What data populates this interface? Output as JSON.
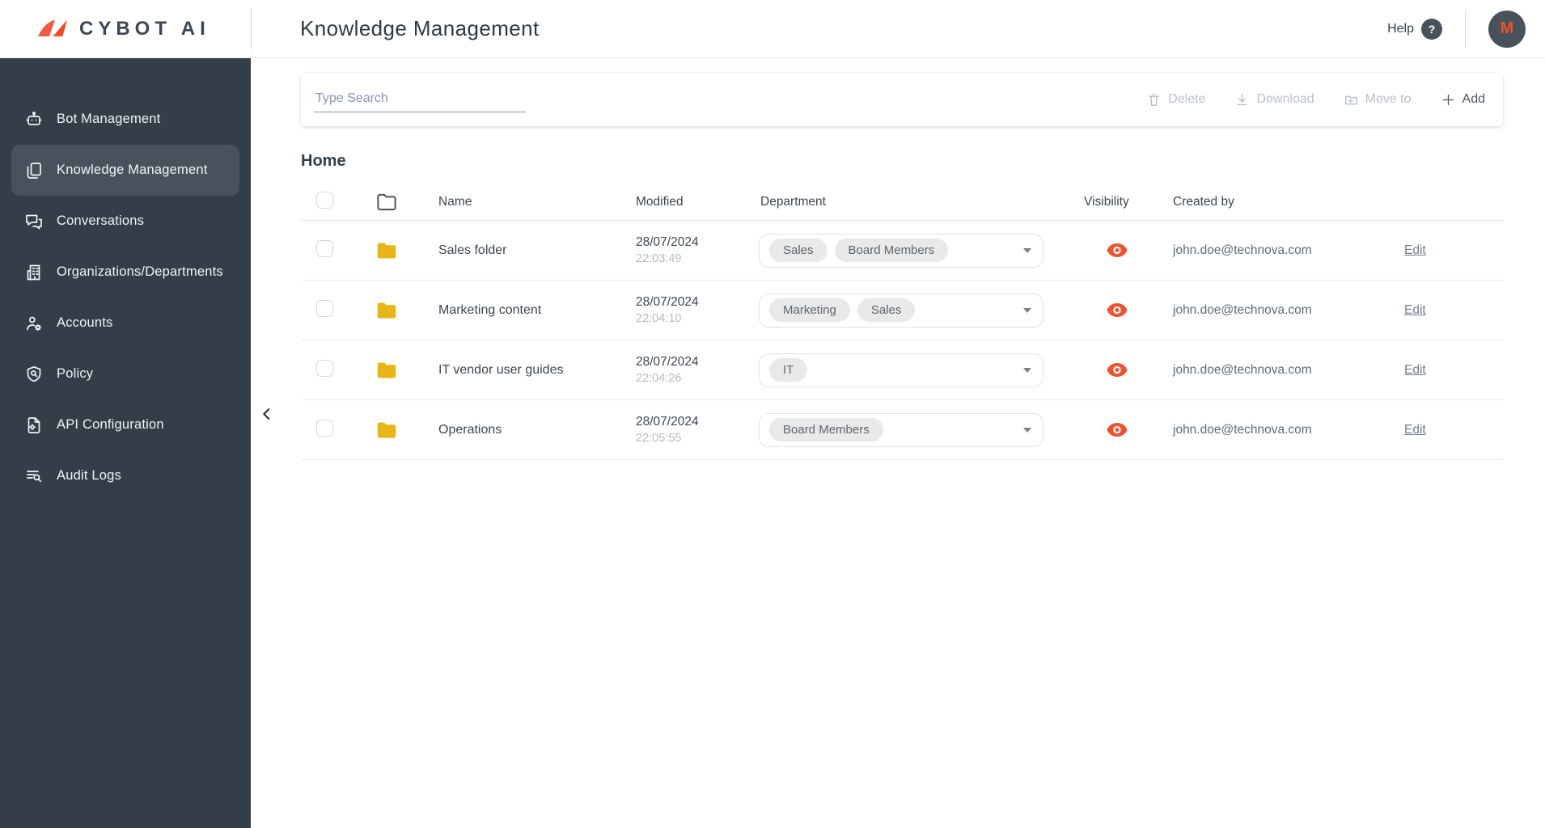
{
  "brand": {
    "name": "CYBOT AI"
  },
  "header": {
    "title": "Knowledge Management",
    "help_label": "Help",
    "help_symbol": "?",
    "avatar_initial": "M"
  },
  "sidebar": {
    "items": [
      {
        "label": "Bot Management",
        "icon": "robot-icon",
        "active": false
      },
      {
        "label": "Knowledge Management",
        "icon": "documents-icon",
        "active": true
      },
      {
        "label": "Conversations",
        "icon": "chat-bubbles-icon",
        "active": false
      },
      {
        "label": "Organizations/Departments",
        "icon": "building-icon",
        "active": false
      },
      {
        "label": "Accounts",
        "icon": "user-gear-icon",
        "active": false
      },
      {
        "label": "Policy",
        "icon": "shield-search-icon",
        "active": false
      },
      {
        "label": "API Configuration",
        "icon": "file-gear-icon",
        "active": false
      },
      {
        "label": "Audit Logs",
        "icon": "list-search-icon",
        "active": false
      }
    ]
  },
  "toolbar": {
    "search_placeholder": "Type Search",
    "search_value": "",
    "delete_label": "Delete",
    "download_label": "Download",
    "move_to_label": "Move to",
    "add_label": "Add"
  },
  "breadcrumb": {
    "current": "Home"
  },
  "table": {
    "columns": {
      "name": "Name",
      "modified": "Modified",
      "department": "Department",
      "visibility": "Visibility",
      "created_by": "Created by"
    },
    "edit_label": "Edit",
    "rows": [
      {
        "name": "Sales folder",
        "modified_date": "28/07/2024",
        "modified_time": "22:03:49",
        "departments": [
          "Sales",
          "Board Members"
        ],
        "visibility": "visible",
        "created_by": "john.doe@technova.com"
      },
      {
        "name": "Marketing content",
        "modified_date": "28/07/2024",
        "modified_time": "22:04:10",
        "departments": [
          "Marketing",
          "Sales"
        ],
        "visibility": "visible",
        "created_by": "john.doe@technova.com"
      },
      {
        "name": "IT vendor user guides",
        "modified_date": "28/07/2024",
        "modified_time": "22:04:26",
        "departments": [
          "IT"
        ],
        "visibility": "visible",
        "created_by": "john.doe@technova.com"
      },
      {
        "name": "Operations",
        "modified_date": "28/07/2024",
        "modified_time": "22:05:55",
        "departments": [
          "Board Members"
        ],
        "visibility": "visible",
        "created_by": "john.doe@technova.com"
      }
    ]
  },
  "colors": {
    "accent_orange": "#f0512e",
    "logo_orange": "#f15b40",
    "sidebar_bg": "#333e48",
    "sidebar_active_bg": "#47525c",
    "folder_yellow": "#e8b517",
    "header_divider_pink": "#f5d2ca",
    "chip_bg": "#e9e9e9"
  }
}
